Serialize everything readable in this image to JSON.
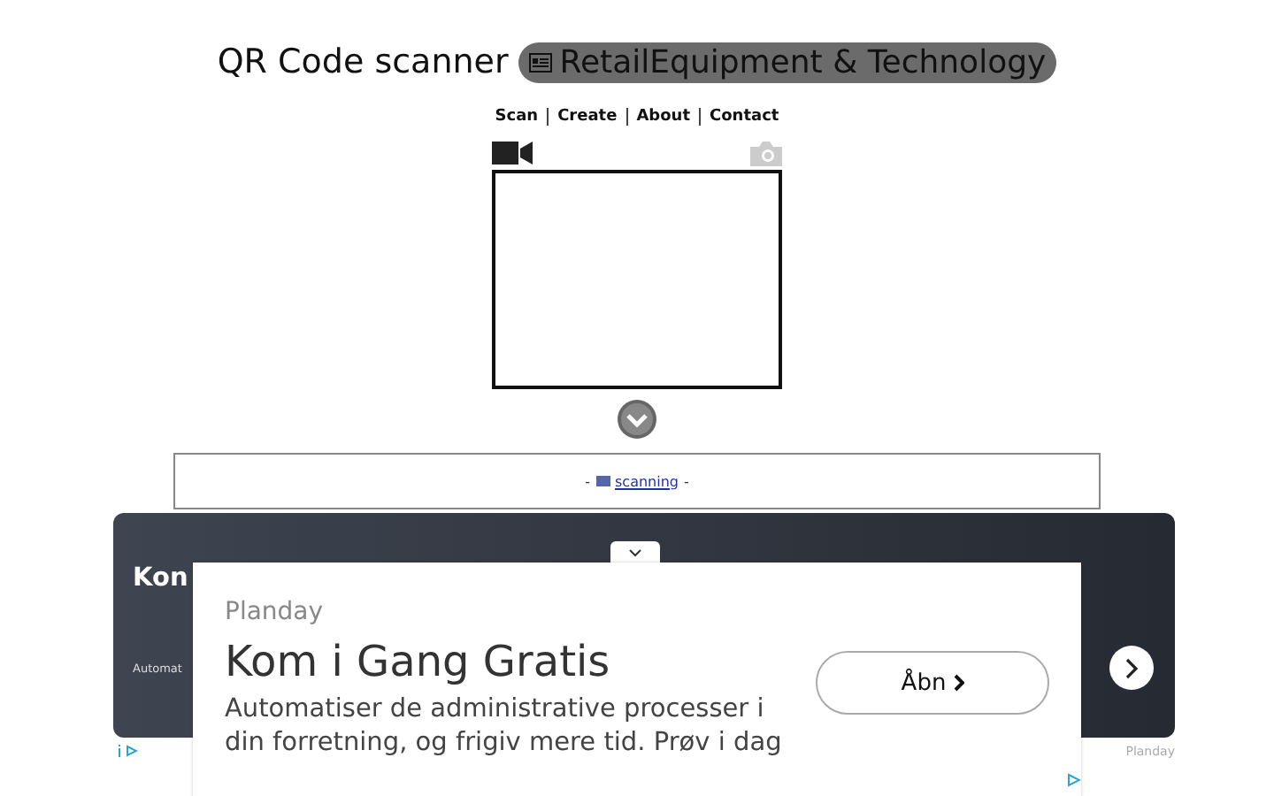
{
  "header": {
    "title": "QR Code scanner",
    "badge": "RetailEquipment & Technology"
  },
  "nav": [
    {
      "label": "Scan"
    },
    {
      "label": "Create"
    },
    {
      "label": "About"
    },
    {
      "label": "Contact"
    }
  ],
  "status": {
    "before": "-",
    "link": "scanning",
    "after": "-"
  },
  "ad": {
    "banner_title": "Kon",
    "banner_text": "Automat",
    "advertiser": "Planday",
    "headline": "Kom i Gang Gratis",
    "body": "Automatiser de administrative processer i din forretning, og frigiv mere tid. Prøv i dag",
    "button": "Åbn",
    "footer_brand": "Planday"
  }
}
